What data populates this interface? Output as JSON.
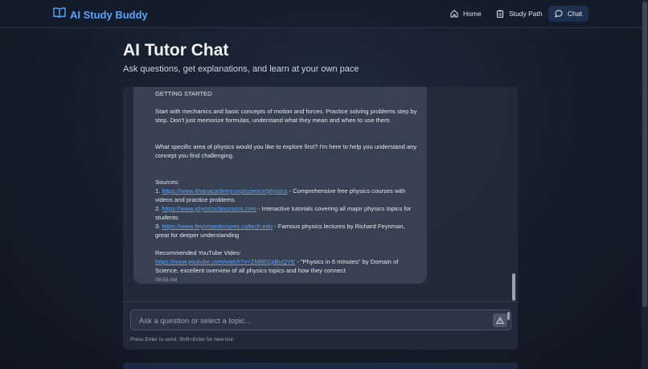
{
  "brand": {
    "name": "AI Study Buddy"
  },
  "nav": {
    "home": "Home",
    "study_path": "Study Path",
    "chat": "Chat"
  },
  "page": {
    "title": "AI Tutor Chat",
    "subtitle": "Ask questions, get explanations, and learn at your own pace"
  },
  "message": {
    "heading": "GETTING STARTED",
    "para1": "Start with mechanics and basic concepts of motion and forces. Practice solving problems step by step. Don't just memorize formulas, understand what they mean and when to use them.",
    "para2": "What specific area of physics would you like to explore first? I'm here to help you understand any concept you find challenging.",
    "sources_label": "Sources:",
    "sources": [
      {
        "num": "1. ",
        "url": "https://www.khanacademy.org/science/physics",
        "desc": " - Comprehensive free physics courses with videos and practice problems"
      },
      {
        "num": "2. ",
        "url": "https://www.physicsclassroom.com",
        "desc": " - Interactive tutorials covering all major physics topics for students"
      },
      {
        "num": "3. ",
        "url": "https://www.feynmanlectures.caltech.edu",
        "desc": " - Famous physics lectures by Richard Feynman, great for deeper understanding"
      }
    ],
    "video_label": "Recommended YouTube Video:",
    "video_url": "https://www.youtube.com/watch?v=ZM8ECpBuQYE",
    "video_desc": " - \"Physics in 6 minutes\" by Domain of Science, excellent overview of all physics topics and how they connect",
    "time": "09:58 AM"
  },
  "input": {
    "placeholder": "Ask a question or select a topic..."
  },
  "hint": "Press Enter to send, Shift+Enter for new line",
  "colors": {
    "accent": "#5aa3f5",
    "link": "#60a5fa",
    "active_nav": "#1d3050"
  },
  "icons": {
    "brand": "book-open-icon",
    "home": "home-icon",
    "study_path": "clipboard-icon",
    "chat": "chat-bubble-icon",
    "send": "warning-triangle-icon"
  }
}
